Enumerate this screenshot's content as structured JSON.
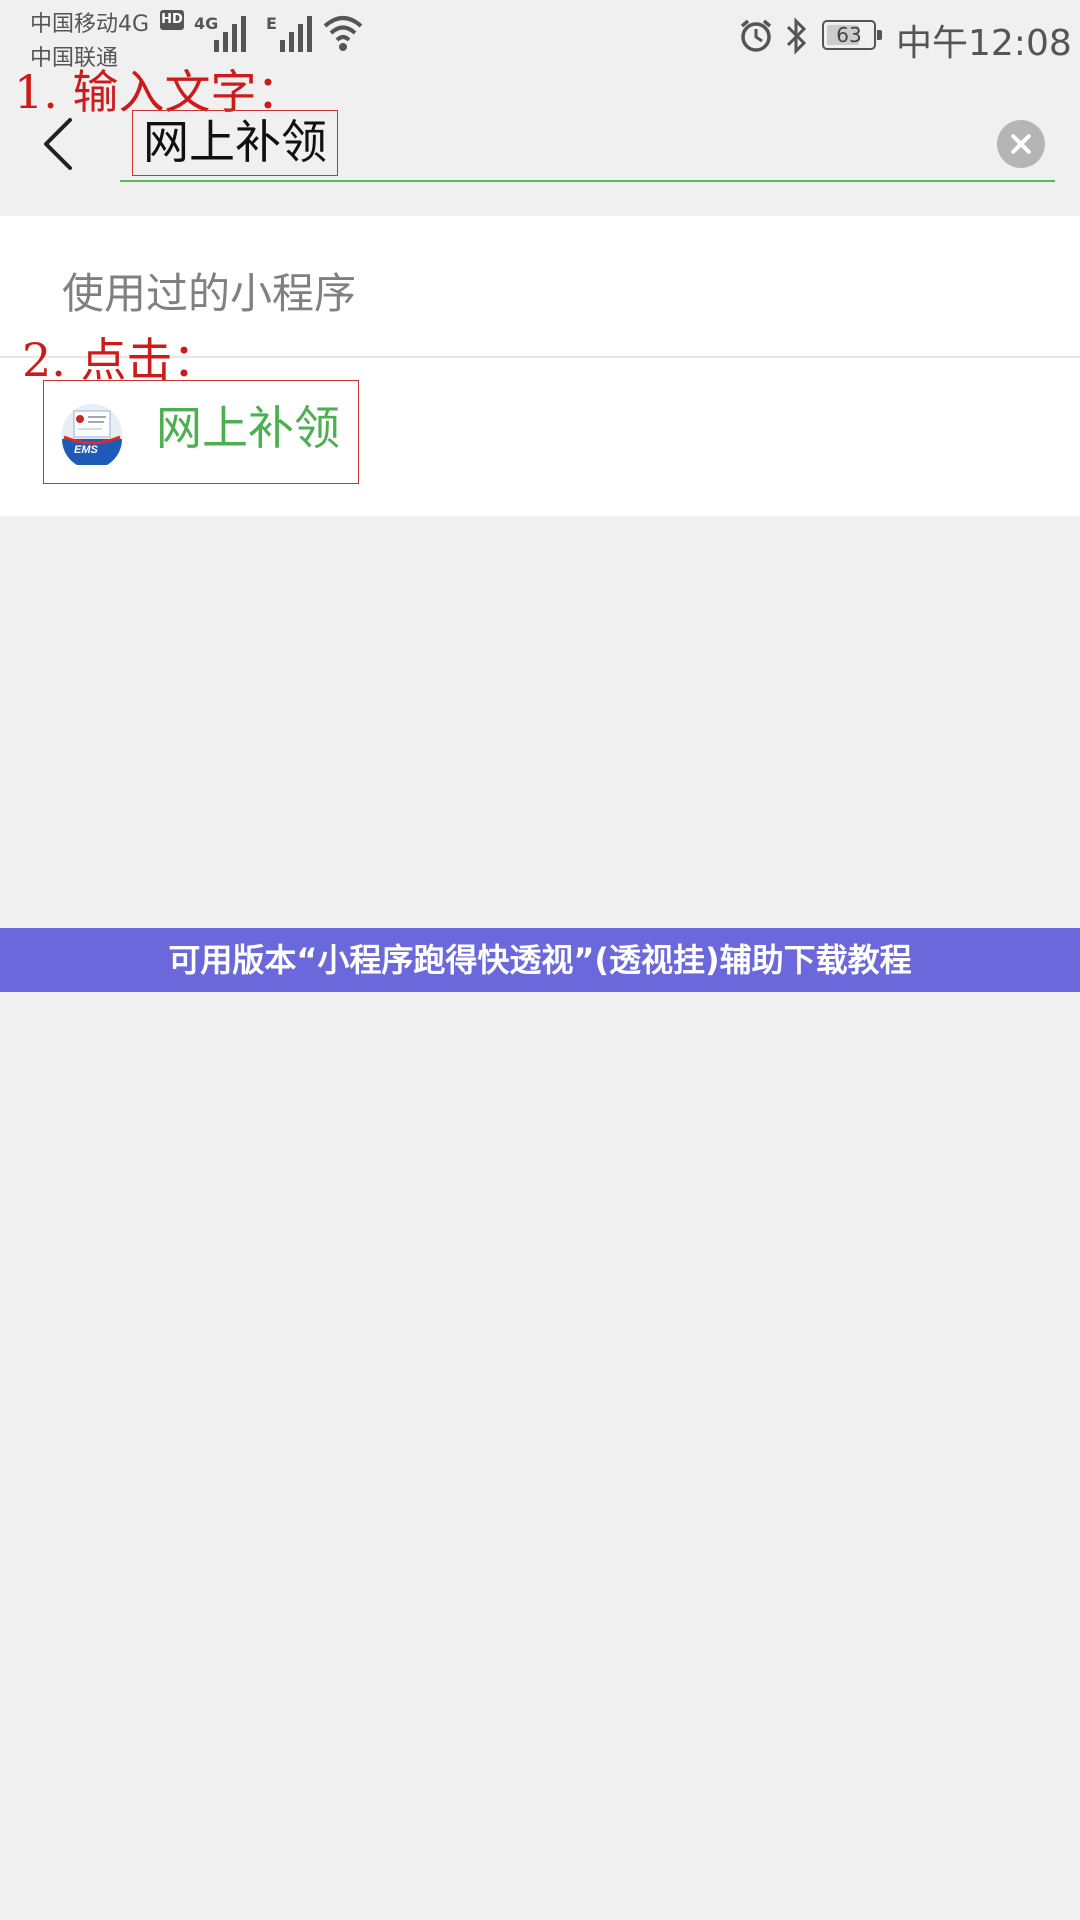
{
  "status_bar": {
    "carrier_primary": "中国移动4G",
    "carrier_secondary": "中国联通",
    "hd_badge": "HD",
    "network_1": "4G",
    "network_2": "E",
    "battery_level": "63",
    "time": "中午12:08",
    "icons": [
      "signal-icon",
      "wifi-icon",
      "alarm-icon",
      "bluetooth-icon",
      "battery-icon"
    ]
  },
  "annotations": {
    "step1": "1. 输入文字：",
    "step2": "2. 点击："
  },
  "search": {
    "back_icon": "back-arrow-icon",
    "query": "网上补领",
    "clear_icon": "clear-icon",
    "underline_color": "#5cb85c"
  },
  "results": {
    "section_title": "使用过的小程序",
    "items": [
      {
        "label": "网上补领",
        "icon": "ems-logo-icon",
        "text_label": "EMS"
      }
    ]
  },
  "banner": {
    "text": "可用版本“小程序跑得快透视”(透视挂)辅助下载教程",
    "color": "#6b68dc"
  },
  "colors": {
    "accent_green": "#4caf50",
    "annotation_red": "#cc1b1b",
    "background": "#f0f0f0"
  }
}
